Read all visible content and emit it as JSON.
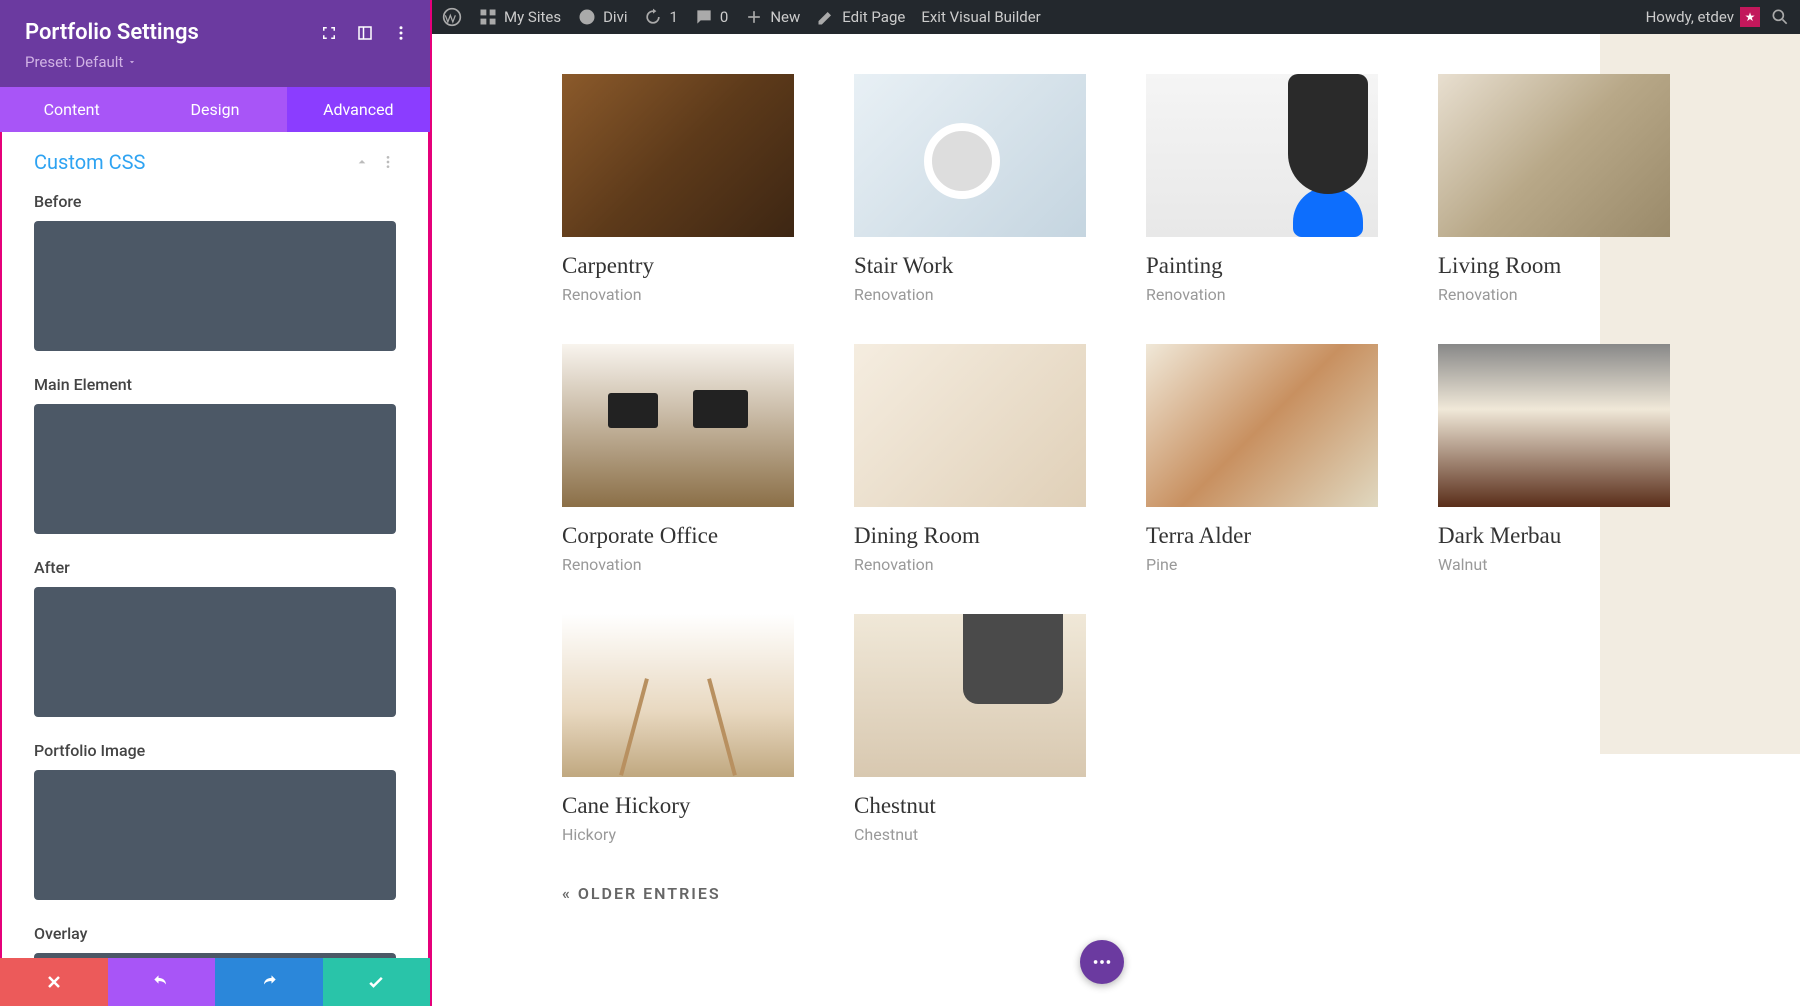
{
  "adminBar": {
    "mySites": "My Sites",
    "divi": "Divi",
    "updates": "1",
    "comments": "0",
    "new": "New",
    "editPage": "Edit Page",
    "exitBuilder": "Exit Visual Builder",
    "howdy": "Howdy, etdev"
  },
  "panel": {
    "title": "Portfolio Settings",
    "preset": "Preset: Default",
    "tabs": {
      "content": "Content",
      "design": "Design",
      "advanced": "Advanced"
    },
    "section": "Custom CSS",
    "fields": {
      "before": "Before",
      "mainElement": "Main Element",
      "after": "After",
      "portfolioImage": "Portfolio Image",
      "overlay": "Overlay"
    }
  },
  "portfolio": {
    "items": [
      {
        "title": "Carpentry",
        "cat": "Renovation",
        "img": "img-carpentry"
      },
      {
        "title": "Stair Work",
        "cat": "Renovation",
        "img": "img-stair"
      },
      {
        "title": "Painting",
        "cat": "Renovation",
        "img": "img-painting"
      },
      {
        "title": "Living Room",
        "cat": "Renovation",
        "img": "img-living"
      },
      {
        "title": "Corporate Office",
        "cat": "Renovation",
        "img": "img-office"
      },
      {
        "title": "Dining Room",
        "cat": "Renovation",
        "img": "img-dining"
      },
      {
        "title": "Terra Alder",
        "cat": "Pine",
        "img": "img-terra"
      },
      {
        "title": "Dark Merbau",
        "cat": "Walnut",
        "img": "img-dark"
      },
      {
        "title": "Cane Hickory",
        "cat": "Hickory",
        "img": "img-cane"
      },
      {
        "title": "Chestnut",
        "cat": "Chestnut",
        "img": "img-chestnut"
      }
    ],
    "olderEntries": "« OLDER ENTRIES"
  }
}
